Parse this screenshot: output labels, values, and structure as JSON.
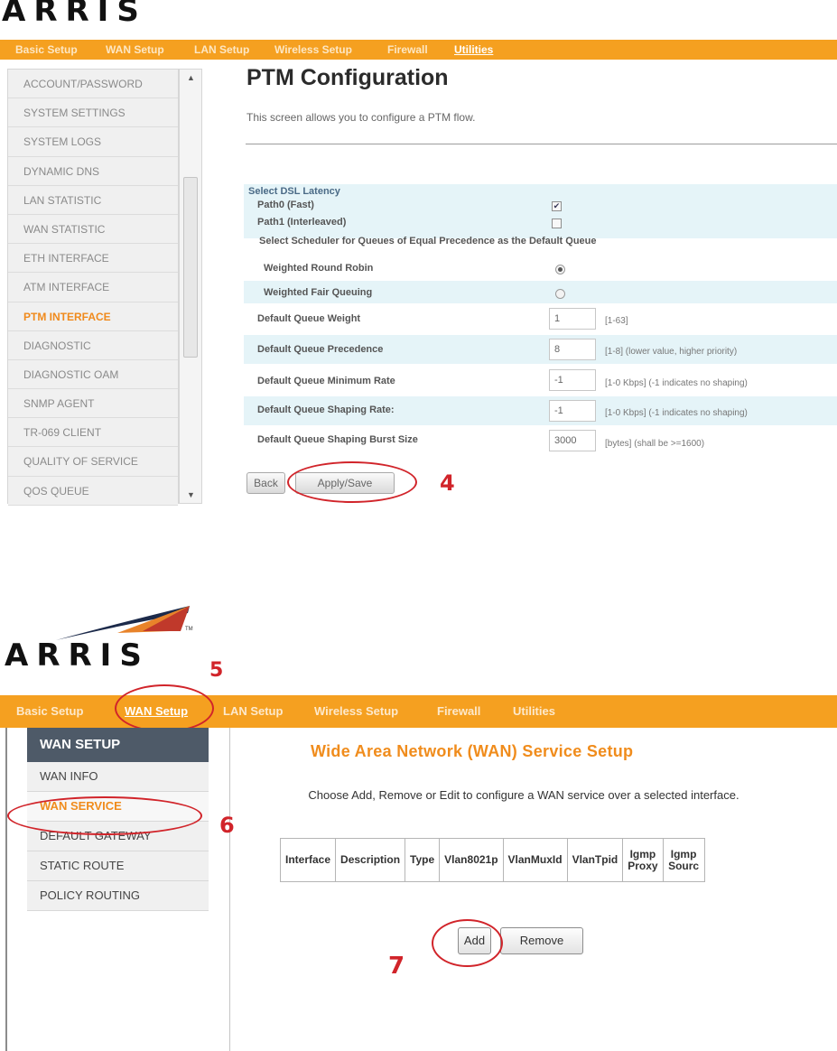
{
  "screen1": {
    "logo_text": "ARRIS",
    "nav": [
      "Basic Setup",
      "WAN Setup",
      "LAN Setup",
      "Wireless Setup",
      "Firewall",
      "Utilities"
    ],
    "nav_selected": "Utilities",
    "sidebar": [
      "ACCOUNT/PASSWORD",
      "SYSTEM SETTINGS",
      "SYSTEM LOGS",
      "DYNAMIC DNS",
      "LAN STATISTIC",
      "WAN STATISTIC",
      "ETH INTERFACE",
      "ATM INTERFACE",
      "PTM INTERFACE",
      "DIAGNOSTIC",
      "DIAGNOSTIC OAM",
      "SNMP AGENT",
      "TR-069 CLIENT",
      "QUALITY OF SERVICE",
      "QOS QUEUE"
    ],
    "sidebar_active": "PTM INTERFACE",
    "page_title": "PTM Configuration",
    "description": "This screen allows you to configure a PTM flow.",
    "latency_heading": "Select DSL Latency",
    "path0_label": "Path0 (Fast)",
    "path0_checked": true,
    "path1_label": "Path1 (Interleaved)",
    "path1_checked": false,
    "scheduler_heading": "Select Scheduler for Queues of Equal Precedence as the Default Queue",
    "wrr_label": "Weighted Round Robin",
    "wrr_selected": true,
    "wfq_label": "Weighted Fair Queuing",
    "wfq_selected": false,
    "fields": [
      {
        "label": "Default Queue Weight",
        "value": "1",
        "hint": "[1-63]"
      },
      {
        "label": "Default Queue Precedence",
        "value": "8",
        "hint": "[1-8] (lower value, higher priority)"
      },
      {
        "label": "Default Queue Minimum Rate",
        "value": "-1",
        "hint": "[1-0 Kbps] (-1 indicates no shaping)"
      },
      {
        "label": "Default Queue Shaping Rate:",
        "value": "-1",
        "hint": "[1-0 Kbps] (-1 indicates no shaping)"
      },
      {
        "label": "Default Queue Shaping Burst Size",
        "value": "3000",
        "hint": "[bytes] (shall be >=1600)"
      }
    ],
    "back_button": "Back",
    "apply_button": "Apply/Save",
    "step_marker": "4"
  },
  "screen2": {
    "logo_text": "ARRIS",
    "tm_mark": "TM",
    "step5": "5",
    "nav": [
      "Basic Setup",
      "WAN Setup",
      "LAN Setup",
      "Wireless Setup",
      "Firewall",
      "Utilities"
    ],
    "nav_selected": "WAN Setup",
    "sidebar_header": "WAN SETUP",
    "sidebar": [
      "WAN INFO",
      "WAN SERVICE",
      "DEFAULT GATEWAY",
      "STATIC ROUTE",
      "POLICY ROUTING"
    ],
    "sidebar_active": "WAN SERVICE",
    "step6": "6",
    "page_title": "Wide Area Network (WAN) Service Setup",
    "description": "Choose Add, Remove or Edit to configure a WAN service over a selected interface.",
    "table_headers": [
      "Interface",
      "Description",
      "Type",
      "Vlan8021p",
      "VlanMuxId",
      "VlanTpid",
      "Igmp Proxy",
      "Igmp Sourc"
    ],
    "add_button": "Add",
    "remove_button": "Remove",
    "step7": "7",
    "colors": {
      "accent_orange": "#f5a020",
      "title_orange": "#f08c1c",
      "annotation_red": "#d1242a",
      "header_slate": "#4e5a68"
    }
  }
}
